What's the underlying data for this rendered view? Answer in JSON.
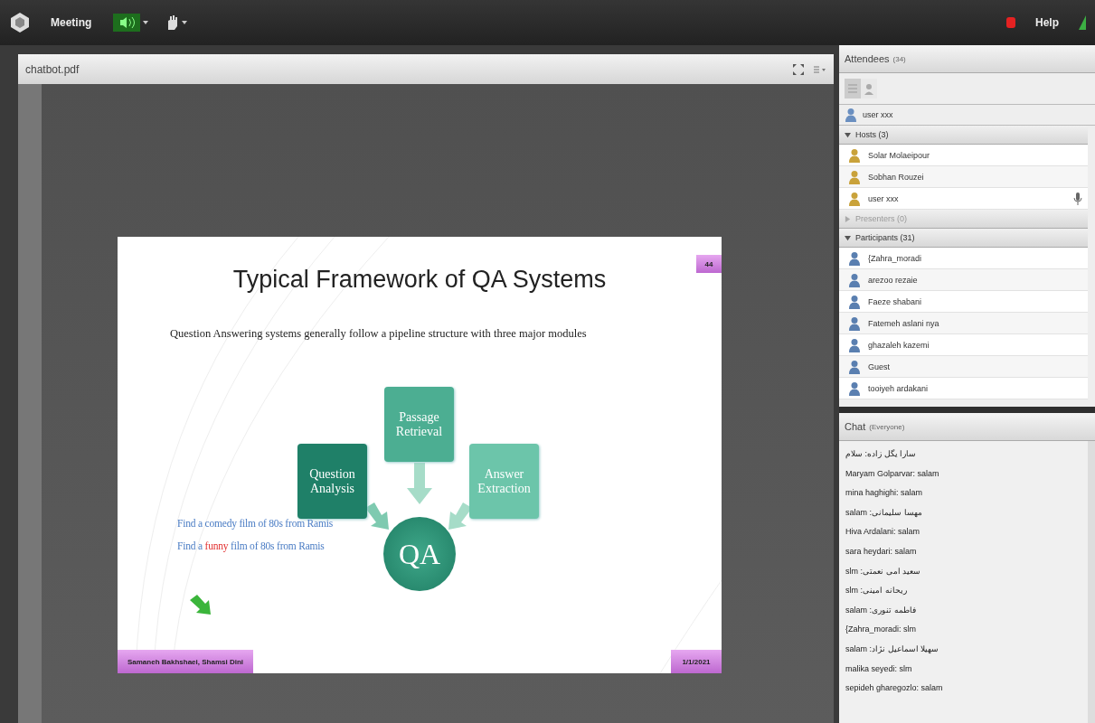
{
  "top_bar": {
    "menu": "Meeting",
    "help": "Help"
  },
  "document": {
    "title": "chatbot.pdf",
    "slide": {
      "page_tab": "44",
      "title": "Typical Framework of QA Systems",
      "subtitle": "Question Answering systems generally follow a pipeline structure with three major modules",
      "boxes": [
        {
          "label": "Passage Retrieval",
          "kind": "top"
        },
        {
          "label": "Question Analysis",
          "kind": "left"
        },
        {
          "label": "Answer Extraction",
          "kind": "right"
        }
      ],
      "center": "QA",
      "examples": [
        {
          "parts": [
            {
              "text": "Find a comedy film of 80s from Ramis",
              "highlight": false
            }
          ]
        },
        {
          "parts": [
            {
              "text": "Find a ",
              "highlight": false
            },
            {
              "text": "funny",
              "highlight": true
            },
            {
              "text": " film of 80s from Ramis",
              "highlight": false
            }
          ]
        }
      ],
      "footer_left": "Samaneh Bakhshaei, Shamsi Dini",
      "footer_right": "1/1/2021"
    }
  },
  "attendees": {
    "title": "Attendees",
    "count": "(34)",
    "me": "user xxx",
    "sections": [
      {
        "label": "Hosts (3)",
        "expanded": true,
        "disabled": false,
        "kind": "host",
        "rows": [
          {
            "name": "Solar Molaeipour",
            "mic": false
          },
          {
            "name": "Sobhan Rouzei",
            "mic": false
          },
          {
            "name": "user xxx",
            "mic": true
          }
        ]
      },
      {
        "label": "Presenters (0)",
        "expanded": false,
        "disabled": true
      },
      {
        "label": "Participants (31)",
        "expanded": true,
        "disabled": false,
        "kind": "participant",
        "rows": [
          {
            "name": "{Zahra_moradi",
            "mic": false
          },
          {
            "name": "arezoo rezaie",
            "mic": false
          },
          {
            "name": "Faeze shabani",
            "mic": false
          },
          {
            "name": "Fatemeh aslani nya",
            "mic": false
          },
          {
            "name": "ghazaleh kazemi",
            "mic": false
          },
          {
            "name": "Guest",
            "mic": false
          },
          {
            "name": "tooiyeh ardakani",
            "mic": false
          }
        ]
      }
    ]
  },
  "chat": {
    "title": "Chat",
    "scope": "(Everyone)",
    "messages": [
      "سارا یگل زاده: سلام",
      "Maryam Golparvar: salam",
      "mina haghighi: salam",
      "مهسا سلیمانی: salam",
      "Hiva Ardalani: salam",
      "sara heydari: salam",
      "سعید امی نعمتی: slm",
      "ریحانه امینی: slm",
      "فاطمه تنوری: salam",
      "{Zahra_moradi: slm",
      "سهیلا اسماعیل نژاد: salam",
      "malika seyedi: slm",
      "sepideh gharegozlo: salam"
    ]
  }
}
